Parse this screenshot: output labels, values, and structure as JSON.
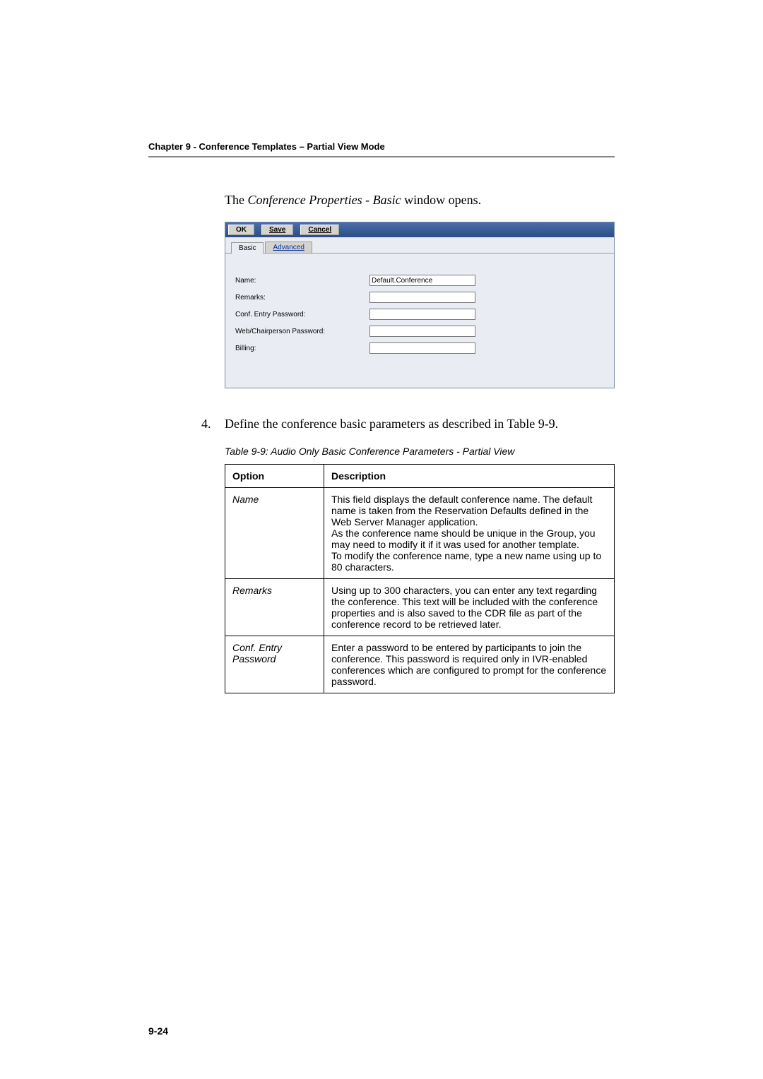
{
  "chapter_header": "Chapter 9 - Conference Templates – Partial View Mode",
  "intro_prefix": "The ",
  "intro_italic": "Conference Properties - Basic",
  "intro_suffix": " window opens.",
  "dialog": {
    "buttons": {
      "ok": "OK",
      "save": "Save",
      "cancel": "Cancel"
    },
    "tabs": {
      "basic": "Basic",
      "advanced": "Advanced"
    },
    "fields": {
      "name_label": "Name:",
      "name_value": "Default.Conference",
      "remarks_label": "Remarks:",
      "remarks_value": "",
      "entry_pw_label": "Conf. Entry Password:",
      "entry_pw_value": "",
      "chair_pw_label": "Web/Chairperson Password:",
      "chair_pw_value": "",
      "billing_label": "Billing:",
      "billing_value": ""
    }
  },
  "step_number": "4.",
  "step_text": "Define the conference basic parameters as described in Table 9-9.",
  "table_caption": "Table 9-9: Audio Only Basic Conference Parameters - Partial View",
  "table": {
    "col1": "Option",
    "col2": "Description",
    "rows": [
      {
        "option": "Name",
        "desc": "This field displays the default conference name. The default name is taken from the Reservation Defaults defined in the Web Server Manager application.\nAs the conference name should be unique in the Group, you may need to modify it if it was used for another template.\nTo modify the conference name, type a new name using up to 80 characters."
      },
      {
        "option": "Remarks",
        "desc": "Using up to 300 characters, you can enter any text regarding the conference. This text will be included with the conference properties and is also saved to the CDR file as part of the conference record to be retrieved later."
      },
      {
        "option": "Conf. Entry Password",
        "desc": "Enter a password to be entered by participants to join the conference. This password is required only in IVR-enabled conferences which are configured to prompt for the conference password."
      }
    ]
  },
  "page_number": "9-24"
}
